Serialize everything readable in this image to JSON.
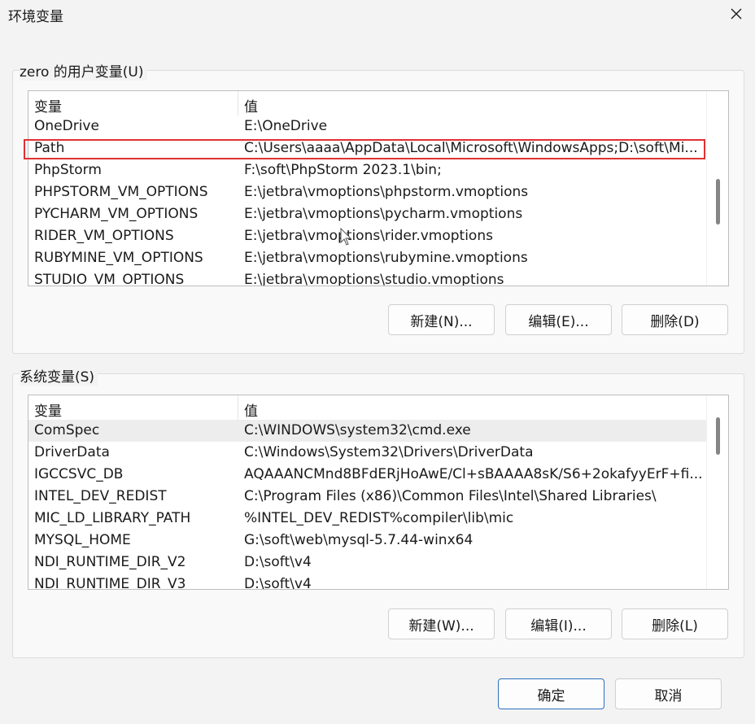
{
  "window": {
    "title": "环境变量",
    "close_icon": "close-icon"
  },
  "user_vars": {
    "group_label": "zero 的用户变量(U)",
    "columns": [
      "变量",
      "值"
    ],
    "rows": [
      {
        "name": "OneDrive",
        "value": "E:\\OneDrive"
      },
      {
        "name": "Path",
        "value": "C:\\Users\\aaaa\\AppData\\Local\\Microsoft\\WindowsApps;D:\\soft\\Mi..."
      },
      {
        "name": "PhpStorm",
        "value": "F:\\soft\\PhpStorm 2023.1\\bin;"
      },
      {
        "name": "PHPSTORM_VM_OPTIONS",
        "value": "E:\\jetbra\\vmoptions\\phpstorm.vmoptions"
      },
      {
        "name": "PYCHARM_VM_OPTIONS",
        "value": "E:\\jetbra\\vmoptions\\pycharm.vmoptions"
      },
      {
        "name": "RIDER_VM_OPTIONS",
        "value": "E:\\jetbra\\vmoptions\\rider.vmoptions"
      },
      {
        "name": "RUBYMINE_VM_OPTIONS",
        "value": "E:\\jetbra\\vmoptions\\rubymine.vmoptions"
      },
      {
        "name": "STUDIO_VM_OPTIONS",
        "value": "E:\\jetbra\\vmoptions\\studio.vmoptions"
      }
    ],
    "buttons": {
      "new": "新建(N)...",
      "edit": "编辑(E)...",
      "delete": "删除(D)"
    }
  },
  "system_vars": {
    "group_label": "系统变量(S)",
    "columns": [
      "变量",
      "值"
    ],
    "rows": [
      {
        "name": "ComSpec",
        "value": "C:\\WINDOWS\\system32\\cmd.exe"
      },
      {
        "name": "DriverData",
        "value": "C:\\Windows\\System32\\Drivers\\DriverData"
      },
      {
        "name": "IGCCSVC_DB",
        "value": "AQAAANCMnd8BFdERjHoAwE/Cl+sBAAAA8sK/S6+2okafyyErF+fi..."
      },
      {
        "name": "INTEL_DEV_REDIST",
        "value": "C:\\Program Files (x86)\\Common Files\\Intel\\Shared Libraries\\"
      },
      {
        "name": "MIC_LD_LIBRARY_PATH",
        "value": "%INTEL_DEV_REDIST%compiler\\lib\\mic"
      },
      {
        "name": "MYSQL_HOME",
        "value": "G:\\soft\\web\\mysql-5.7.44-winx64"
      },
      {
        "name": "NDI_RUNTIME_DIR_V2",
        "value": "D:\\soft\\v4"
      },
      {
        "name": "NDI_RUNTIME_DIR_V3",
        "value": "D:\\soft\\v4"
      }
    ],
    "buttons": {
      "new": "新建(W)...",
      "edit": "编辑(I)...",
      "delete": "删除(L)"
    }
  },
  "footer": {
    "ok": "确定",
    "cancel": "取消"
  },
  "colors": {
    "highlight_border": "#e03131",
    "primary_button_border": "#2d6fbf",
    "selected_row": "#ededed"
  }
}
